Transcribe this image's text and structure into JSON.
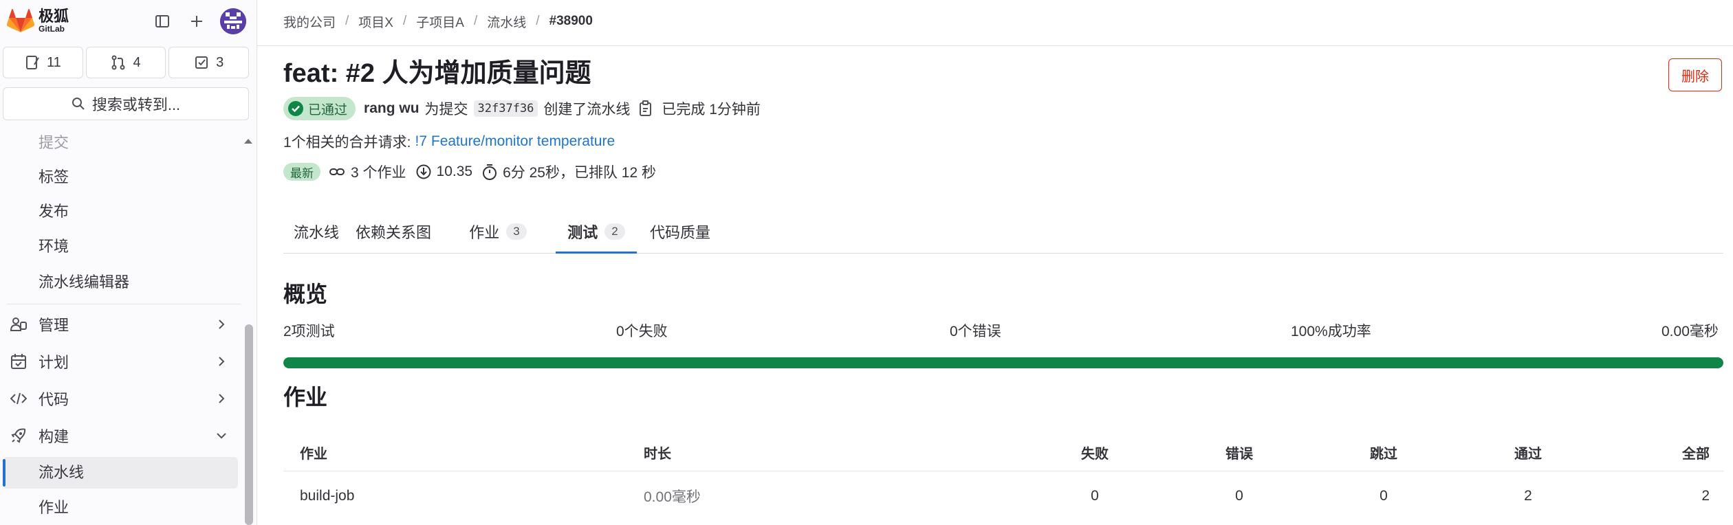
{
  "brand": {
    "name_cn": "极狐",
    "name_en": "GitLab",
    "logo_color": "#e24329"
  },
  "sidebar": {
    "counters": [
      {
        "icon": "issues-icon",
        "count": "11"
      },
      {
        "icon": "merge-request-icon",
        "count": "4"
      },
      {
        "icon": "todo-icon",
        "count": "3"
      }
    ],
    "search_label": "搜索或转到...",
    "sub_items": [
      "提交",
      "标签",
      "发布",
      "环境",
      "流水线编辑器"
    ],
    "groups": [
      {
        "icon": "users-icon",
        "label": "管理"
      },
      {
        "icon": "calendar-icon",
        "label": "计划"
      },
      {
        "icon": "code-icon",
        "label": "代码"
      },
      {
        "icon": "rocket-icon",
        "label": "构建"
      }
    ],
    "build_items": [
      "流水线",
      "作业"
    ],
    "active_color": "#1f75cb"
  },
  "breadcrumb": [
    "我的公司",
    "项目X",
    "子项目A",
    "流水线",
    "#38900"
  ],
  "pipeline": {
    "title": "feat: #2 人为增加质量问题",
    "delete_label": "删除",
    "status": "已通过",
    "author": "rang wu",
    "for_commit_text": "为提交",
    "commit_sha": "32f37f36",
    "created_text": "创建了流水线",
    "finished_text": "已完成 1分钟前",
    "related_mr_prefix": "1个相关的合并请求:",
    "related_mr_link": "!7 Feature/monitor temperature",
    "latest_badge": "最新",
    "jobs_count_text": "3 个作业",
    "version": "10.35",
    "duration_text": "6分 25秒，已排队 12 秒"
  },
  "tabs": [
    {
      "label": "流水线",
      "count": ""
    },
    {
      "label": "依赖关系图",
      "count": ""
    },
    {
      "label": "作业",
      "count": "3"
    },
    {
      "label": "测试",
      "count": "2"
    },
    {
      "label": "代码质量",
      "count": ""
    }
  ],
  "overview": {
    "title": "概览",
    "tests": "2项测试",
    "failures": "0个失败",
    "errors": "0个错误",
    "success_rate": "100%成功率",
    "duration": "0.00毫秒",
    "success_fraction": 1.0,
    "success_color": "#108548"
  },
  "jobs": {
    "title": "作业",
    "headers": [
      "作业",
      "时长",
      "失败",
      "错误",
      "跳过",
      "通过",
      "全部"
    ],
    "rows": [
      {
        "name": "build-job",
        "duration": "0.00毫秒",
        "failed": "0",
        "errors": "0",
        "skipped": "0",
        "passed": "2",
        "total": "2"
      }
    ]
  }
}
